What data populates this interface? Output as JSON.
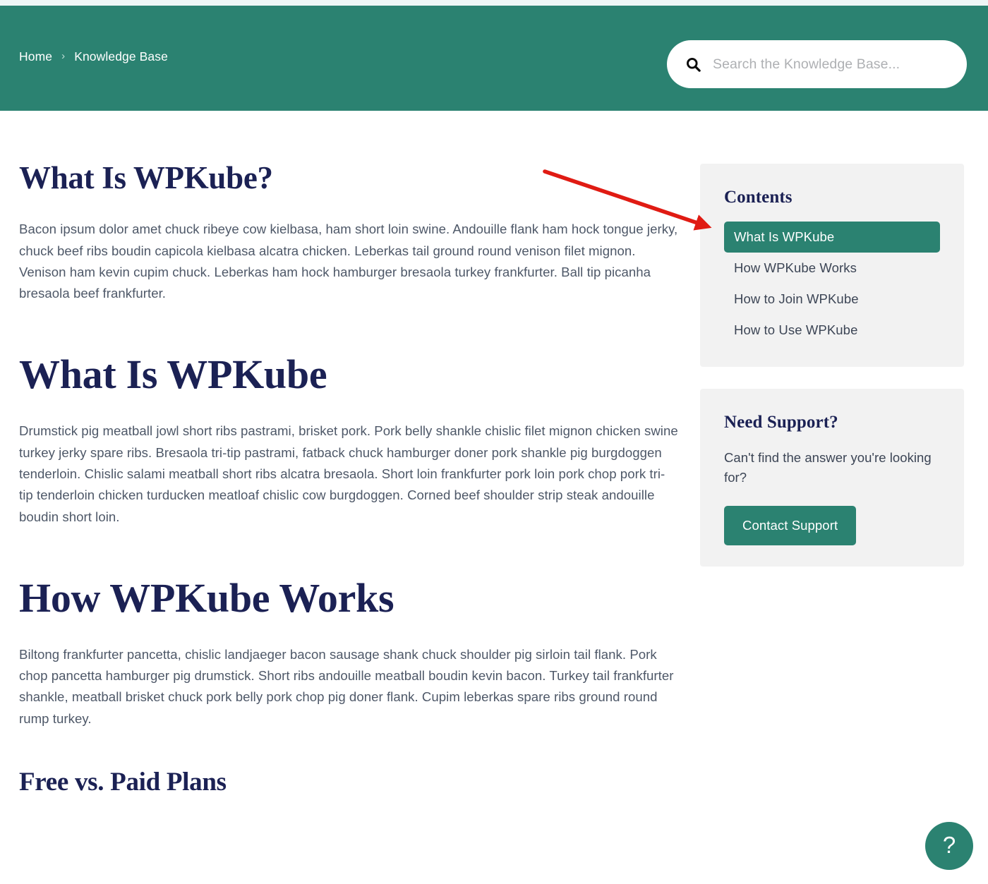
{
  "header": {
    "background_color": "#2b8271",
    "breadcrumb": {
      "home_label": "Home",
      "separator": "›",
      "current_label": "Knowledge Base"
    },
    "search": {
      "icon": "search-icon",
      "placeholder": "Search the Knowledge Base...",
      "value": ""
    }
  },
  "article": {
    "title": "What Is WPKube?",
    "sections": [
      {
        "level": "h1",
        "heading": "What Is WPKube?",
        "body": "Bacon ipsum dolor amet chuck ribeye cow kielbasa, ham short loin swine. Andouille flank ham hock tongue jerky, chuck beef ribs boudin capicola kielbasa alcatra chicken. Leberkas tail ground round venison filet mignon. Venison ham kevin cupim chuck. Leberkas ham hock hamburger bresaola turkey frankfurter. Ball tip picanha bresaola beef frankfurter."
      },
      {
        "level": "h2",
        "heading": "What Is WPKube",
        "body": "Drumstick pig meatball jowl short ribs pastrami, brisket pork. Pork belly shankle chislic filet mignon chicken swine turkey jerky spare ribs. Bresaola tri-tip pastrami, fatback chuck hamburger doner pork shankle pig burgdoggen tenderloin. Chislic salami meatball short ribs alcatra bresaola. Short loin frankfurter pork loin pork chop pork tri-tip tenderloin chicken turducken meatloaf chislic cow burgdoggen. Corned beef shoulder strip steak andouille boudin short loin."
      },
      {
        "level": "h2",
        "heading": "How WPKube Works",
        "body": "Biltong frankfurter pancetta, chislic landjaeger bacon sausage shank chuck shoulder pig sirloin tail flank. Pork chop pancetta hamburger pig drumstick. Short ribs andouille meatball boudin kevin bacon. Turkey tail frankfurter shankle, meatball brisket chuck pork belly pork chop pig doner flank. Cupim leberkas spare ribs ground round rump turkey."
      },
      {
        "level": "h3",
        "heading": "Free vs. Paid Plans",
        "body": ""
      }
    ]
  },
  "sidebar": {
    "contents": {
      "title": "Contents",
      "items": [
        {
          "label": "What Is WPKube",
          "active": true
        },
        {
          "label": "How WPKube Works",
          "active": false
        },
        {
          "label": "How to Join WPKube",
          "active": false
        },
        {
          "label": "How to Use WPKube",
          "active": false
        }
      ]
    },
    "support": {
      "title": "Need Support?",
      "text": "Can't find the answer you're looking for?",
      "button_label": "Contact Support"
    }
  },
  "annotation": {
    "type": "arrow",
    "color": "#e01b13",
    "points_to": "contents-item-active"
  },
  "help_button": {
    "label": "?",
    "color": "#2b8271"
  },
  "colors": {
    "brand_teal": "#2b8271",
    "heading_navy": "#1b2154",
    "body_gray": "#4e5868",
    "card_bg": "#f2f2f2",
    "annotation_red": "#e01b13"
  }
}
